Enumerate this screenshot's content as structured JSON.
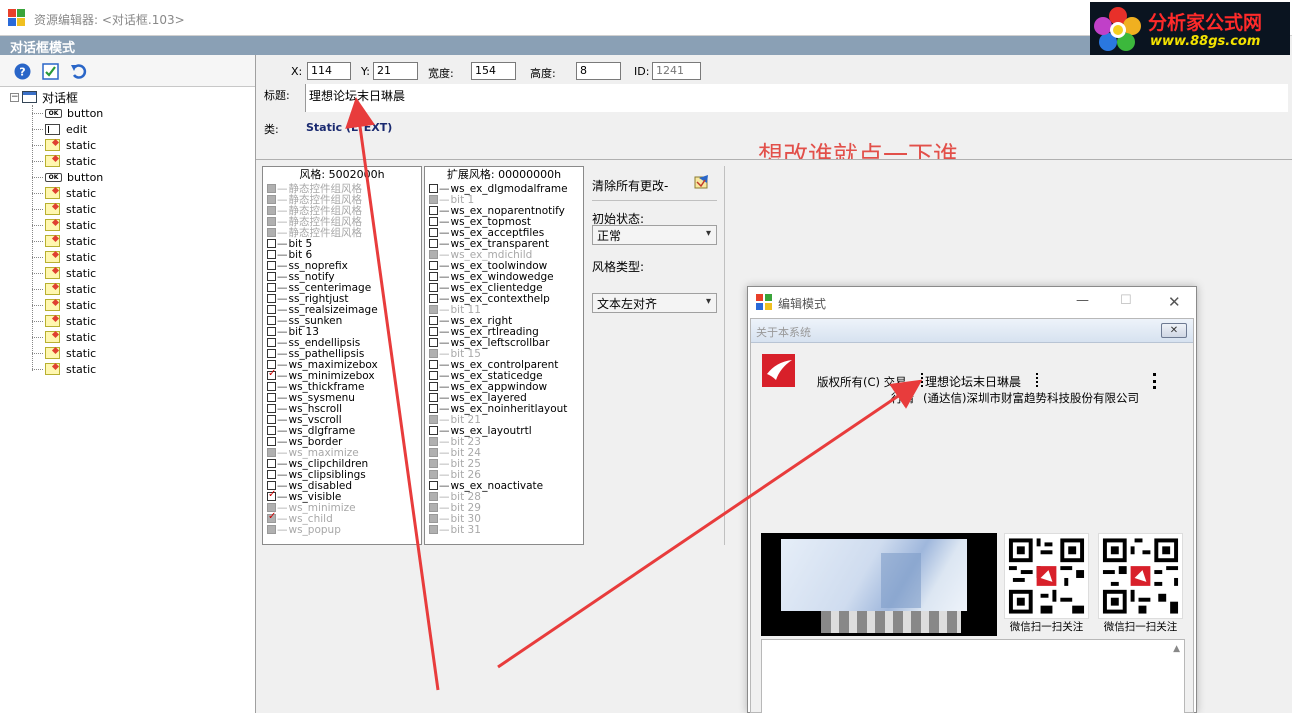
{
  "window": {
    "title": "资源编辑器: <对话框.103>",
    "mode_label": "对话框模式"
  },
  "logo": {
    "title": "分析家公式网",
    "url": "www.88gs.com"
  },
  "toolbar": {
    "buttons": [
      "help-icon",
      "apply-icon",
      "undo-icon"
    ]
  },
  "tree": {
    "root": "对话框",
    "items": [
      {
        "type": "button",
        "label": "button"
      },
      {
        "type": "edit",
        "label": "edit"
      },
      {
        "type": "static",
        "label": "static"
      },
      {
        "type": "static",
        "label": "static"
      },
      {
        "type": "button",
        "label": "button"
      },
      {
        "type": "static",
        "label": "static"
      },
      {
        "type": "static",
        "label": "static"
      },
      {
        "type": "static",
        "label": "static"
      },
      {
        "type": "static",
        "label": "static"
      },
      {
        "type": "static",
        "label": "static"
      },
      {
        "type": "static",
        "label": "static"
      },
      {
        "type": "static",
        "label": "static"
      },
      {
        "type": "static",
        "label": "static"
      },
      {
        "type": "static",
        "label": "static"
      },
      {
        "type": "static",
        "label": "static"
      },
      {
        "type": "static",
        "label": "static"
      },
      {
        "type": "static",
        "label": "static"
      }
    ],
    "button_icon_text": "OK"
  },
  "props": {
    "x_label": "X:",
    "x_value": "114",
    "y_label": "Y:",
    "y_value": "21",
    "width_label": "宽度:",
    "width_value": "154",
    "height_label": "高度:",
    "height_value": "8",
    "id_label": "ID:",
    "id_value": "1241",
    "title_label": "标题:",
    "title_value": "理想论坛末日琳晨",
    "class_label": "类:",
    "class_value": "Static (LTEXT)"
  },
  "annotation": "想改谁就点一下谁",
  "styles": {
    "header": "风格: 5002000h",
    "items": [
      {
        "label": "静态控件组风格",
        "state": "grey",
        "active": false
      },
      {
        "label": "静态控件组风格",
        "state": "grey",
        "active": false
      },
      {
        "label": "静态控件组风格",
        "state": "grey",
        "active": false
      },
      {
        "label": "静态控件组风格",
        "state": "grey",
        "active": false
      },
      {
        "label": "静态控件组风格",
        "state": "grey",
        "active": false
      },
      {
        "label": "bit 5",
        "state": "empty",
        "active": false
      },
      {
        "label": "bit 6",
        "state": "empty",
        "active": false
      },
      {
        "label": "ss_noprefix",
        "state": "empty",
        "active": false
      },
      {
        "label": "ss_notify",
        "state": "empty",
        "active": false
      },
      {
        "label": "ss_centerimage",
        "state": "empty",
        "active": false
      },
      {
        "label": "ss_rightjust",
        "state": "empty",
        "active": false
      },
      {
        "label": "ss_realsizeimage",
        "state": "empty",
        "active": false
      },
      {
        "label": "ss_sunken",
        "state": "empty",
        "active": false
      },
      {
        "label": "bit 13",
        "state": "empty",
        "active": false
      },
      {
        "label": "ss_endellipsis",
        "state": "empty",
        "active": false
      },
      {
        "label": "ss_pathellipsis",
        "state": "empty",
        "active": false
      },
      {
        "label": "ws_maximizebox",
        "state": "empty",
        "active": false
      },
      {
        "label": "ws_minimizebox",
        "state": "checked",
        "active": true
      },
      {
        "label": "ws_thickframe",
        "state": "empty",
        "active": false
      },
      {
        "label": "ws_sysmenu",
        "state": "empty",
        "active": false
      },
      {
        "label": "ws_hscroll",
        "state": "empty",
        "active": false
      },
      {
        "label": "ws_vscroll",
        "state": "empty",
        "active": false
      },
      {
        "label": "ws_dlgframe",
        "state": "empty",
        "active": false
      },
      {
        "label": "ws_border",
        "state": "empty",
        "active": false
      },
      {
        "label": "ws_maximize",
        "state": "grey",
        "active": false
      },
      {
        "label": "ws_clipchildren",
        "state": "empty",
        "active": false
      },
      {
        "label": "ws_clipsiblings",
        "state": "empty",
        "active": false
      },
      {
        "label": "ws_disabled",
        "state": "empty",
        "active": false
      },
      {
        "label": "ws_visible",
        "state": "checked",
        "active": true
      },
      {
        "label": "ws_minimize",
        "state": "grey",
        "active": false
      },
      {
        "label": "ws_child",
        "state": "checked-grey",
        "active": false
      },
      {
        "label": "ws_popup",
        "state": "grey",
        "active": false
      }
    ]
  },
  "exstyles": {
    "header": "扩展风格: 00000000h",
    "items": [
      {
        "label": "ws_ex_dlgmodalframe",
        "state": "empty",
        "active": false
      },
      {
        "label": "bit 1",
        "state": "grey",
        "active": false
      },
      {
        "label": "ws_ex_noparentnotify",
        "state": "empty",
        "active": false
      },
      {
        "label": "ws_ex_topmost",
        "state": "empty",
        "active": false
      },
      {
        "label": "ws_ex_acceptfiles",
        "state": "empty",
        "active": false
      },
      {
        "label": "ws_ex_transparent",
        "state": "empty",
        "active": false
      },
      {
        "label": "ws_ex_mdichild",
        "state": "grey",
        "active": false
      },
      {
        "label": "ws_ex_toolwindow",
        "state": "empty",
        "active": false
      },
      {
        "label": "ws_ex_windowedge",
        "state": "empty",
        "active": false
      },
      {
        "label": "ws_ex_clientedge",
        "state": "empty",
        "active": false
      },
      {
        "label": "ws_ex_contexthelp",
        "state": "empty",
        "active": false
      },
      {
        "label": "bit 11",
        "state": "grey",
        "active": false
      },
      {
        "label": "ws_ex_right",
        "state": "empty",
        "active": false
      },
      {
        "label": "ws_ex_rtlreading",
        "state": "empty",
        "active": false
      },
      {
        "label": "ws_ex_leftscrollbar",
        "state": "empty",
        "active": false
      },
      {
        "label": "bit 15",
        "state": "grey",
        "active": false
      },
      {
        "label": "ws_ex_controlparent",
        "state": "empty",
        "active": false
      },
      {
        "label": "ws_ex_staticedge",
        "state": "empty",
        "active": false
      },
      {
        "label": "ws_ex_appwindow",
        "state": "empty",
        "active": false
      },
      {
        "label": "ws_ex_layered",
        "state": "empty",
        "active": false
      },
      {
        "label": "ws_ex_noinheritlayout",
        "state": "empty",
        "active": false
      },
      {
        "label": "bit 21",
        "state": "grey",
        "active": false
      },
      {
        "label": "ws_ex_layoutrtl",
        "state": "empty",
        "active": false
      },
      {
        "label": "bit 23",
        "state": "grey",
        "active": false
      },
      {
        "label": "bit 24",
        "state": "grey",
        "active": false
      },
      {
        "label": "bit 25",
        "state": "grey",
        "active": false
      },
      {
        "label": "bit 26",
        "state": "grey",
        "active": false
      },
      {
        "label": "ws_ex_noactivate",
        "state": "empty",
        "active": false
      },
      {
        "label": "bit 28",
        "state": "grey",
        "active": false
      },
      {
        "label": "bit 29",
        "state": "grey",
        "active": false
      },
      {
        "label": "bit 30",
        "state": "grey",
        "active": false
      },
      {
        "label": "bit 31",
        "state": "grey",
        "active": false
      }
    ]
  },
  "options": {
    "clear_label": "清除所有更改-",
    "initial_state_label": "初始状态:",
    "initial_state_value": "正常",
    "style_type_label": "风格类型:",
    "style_type_value": "文本左对齐"
  },
  "edit_window": {
    "title": "编辑模式",
    "about_title": "关于本系统",
    "copyright": "版权所有(C) 交易",
    "line1_value": "理想论坛末日琳晨",
    "line2_prefix": "行情",
    "line2_value": "(通达信)深圳市财富趋势科技股份有限公司",
    "qr1_label": "微信扫一扫关注",
    "qr2_label": "微信扫一扫关注"
  },
  "colors": {
    "mode_bar": "#8aa0b5",
    "annotation": "#e2504a",
    "arrow": "#e83c3c",
    "checkmark": "#cc0000"
  }
}
